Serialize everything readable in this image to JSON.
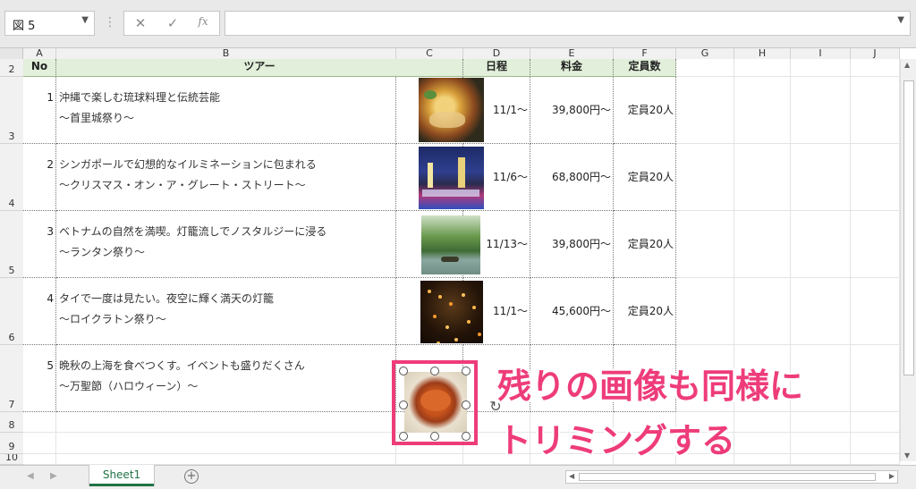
{
  "formula_bar": {
    "name_box": "図 5",
    "cancel_icon": "✕",
    "enter_icon": "✓",
    "function_icon": "fx",
    "formula": ""
  },
  "columns": [
    "A",
    "B",
    "C",
    "D",
    "E",
    "F",
    "G",
    "H",
    "I",
    "J"
  ],
  "rows": [
    "2",
    "3",
    "4",
    "5",
    "6",
    "7",
    "8",
    "9",
    "10"
  ],
  "table": {
    "headers": {
      "no": "No",
      "tour": "ツアー",
      "date": "日程",
      "price": "料金",
      "capacity": "定員数"
    },
    "entries": [
      {
        "no": "1",
        "line1": "沖縄で楽しむ琉球料理と伝統芸能",
        "line2": "～首里城祭り～",
        "date": "11/1～",
        "price": "39,800円～",
        "capacity": "定員20人"
      },
      {
        "no": "2",
        "line1": "シンガポールで幻想的なイルミネーションに包まれる",
        "line2": "～クリスマス・オン・ア・グレート・ストリート～",
        "date": "11/6～",
        "price": "68,800円～",
        "capacity": "定員20人"
      },
      {
        "no": "3",
        "line1": "ベトナムの自然を満喫。灯籠流しでノスタルジーに浸る",
        "line2": "～ランタン祭り～",
        "date": "11/13～",
        "price": "39,800円～",
        "capacity": "定員20人"
      },
      {
        "no": "4",
        "line1": "タイで一度は見たい。夜空に輝く満天の灯籠",
        "line2": "～ロイクラトン祭り～",
        "date": "11/1～",
        "price": "45,600円～",
        "capacity": "定員20人"
      },
      {
        "no": "5",
        "line1": "晩秋の上海を食べつくす。イベントも盛りだくさん",
        "line2": "～万聖節（ハロウィーン）～",
        "date": "1",
        "price": "7",
        "capacity": ""
      }
    ]
  },
  "sheet_tab": "Sheet1",
  "add_sheet_icon": "+",
  "annotation": {
    "line1": "残りの画像も同様に",
    "line2": "トリミングする",
    "color": "#ee3c7a"
  }
}
